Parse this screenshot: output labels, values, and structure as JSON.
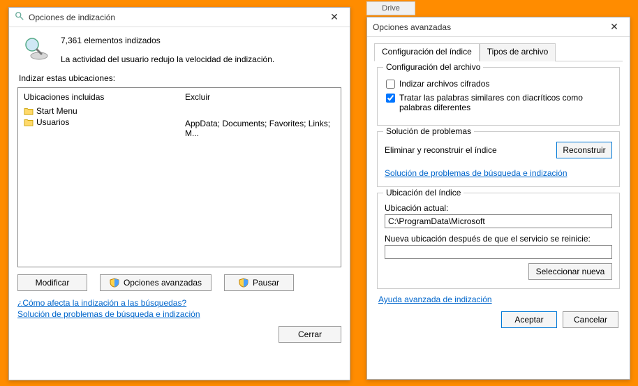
{
  "drive_tab": "Drive",
  "main": {
    "title": "Opciones de indización",
    "status_count": "7,361 elementos indizados",
    "status_msg": "La actividad del usuario redujo la velocidad de indización.",
    "section_label": "Indizar estas ubicaciones:",
    "col1_header": "Ubicaciones incluidas",
    "col2_header": "Excluir",
    "items": [
      {
        "label": "Start Menu"
      },
      {
        "label": "Usuarios"
      }
    ],
    "exclude_value": "AppData; Documents; Favorites; Links; M...",
    "buttons": {
      "modify": "Modificar",
      "advanced": "Opciones avanzadas",
      "pause": "Pausar",
      "close": "Cerrar"
    },
    "links": {
      "how_affects": "¿Cómo afecta la indización a las búsquedas?",
      "troubleshoot": "Solución de problemas de búsqueda e indización"
    }
  },
  "adv": {
    "title": "Opciones avanzadas",
    "tabs": {
      "index": "Configuración del índice",
      "filetypes": "Tipos de archivo"
    },
    "file_config": {
      "legend": "Configuración del archivo",
      "cb_encrypted": "Indizar archivos cifrados",
      "cb_diacritics": "Tratar las palabras similares con diacríticos como palabras diferentes"
    },
    "troubleshoot": {
      "legend": "Solución de problemas",
      "rebuild_text": "Eliminar y reconstruir el índice",
      "rebuild_btn": "Reconstruir",
      "link": "Solución de problemas de búsqueda e indización"
    },
    "location": {
      "legend": "Ubicación del índice",
      "current_label": "Ubicación actual:",
      "current_value": "C:\\ProgramData\\Microsoft",
      "new_label": "Nueva ubicación después de que el servicio se reinicie:",
      "new_value": "",
      "select_new": "Seleccionar nueva"
    },
    "help_link": "Ayuda avanzada de indización",
    "accept": "Aceptar",
    "cancel": "Cancelar"
  }
}
